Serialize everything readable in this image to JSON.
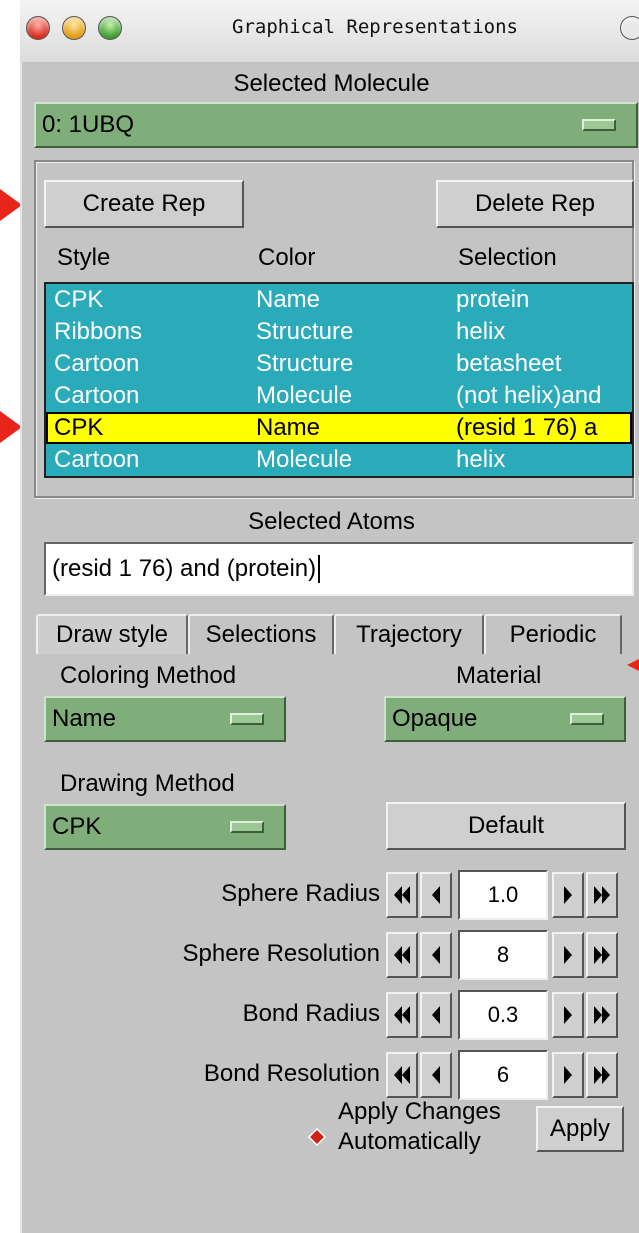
{
  "window": {
    "title": "Graphical Representations"
  },
  "selected_molecule": {
    "label": "Selected Molecule",
    "value": "0: 1UBQ"
  },
  "reps": {
    "create_label": "Create Rep",
    "delete_label": "Delete Rep",
    "columns": [
      "Style",
      "Color",
      "Selection"
    ],
    "rows": [
      {
        "style": "CPK",
        "color": "Name",
        "selection": "protein",
        "selected": false
      },
      {
        "style": "Ribbons",
        "color": "Structure",
        "selection": "helix",
        "selected": false
      },
      {
        "style": "Cartoon",
        "color": "Structure",
        "selection": "betasheet",
        "selected": false
      },
      {
        "style": "Cartoon",
        "color": "Molecule",
        "selection": "(not helix)and",
        "selected": false
      },
      {
        "style": "CPK",
        "color": "Name",
        "selection": "(resid 1 76) a",
        "selected": true
      },
      {
        "style": "Cartoon",
        "color": "Molecule",
        "selection": "helix",
        "selected": false
      }
    ],
    "list_color": "#2baab9",
    "selected_row_color": "#ffff00"
  },
  "selected_atoms": {
    "label": "Selected Atoms",
    "value": "(resid 1 76) and (protein)"
  },
  "tabs": [
    "Draw style",
    "Selections",
    "Trajectory",
    "Periodic"
  ],
  "active_tab": "Draw style",
  "draw_style": {
    "coloring_method_label": "Coloring Method",
    "coloring_method_value": "Name",
    "material_label": "Material",
    "material_value": "Opaque",
    "drawing_method_label": "Drawing Method",
    "drawing_method_value": "CPK",
    "default_label": "Default",
    "params": [
      {
        "label": "Sphere Radius",
        "value": "1.0"
      },
      {
        "label": "Sphere Resolution",
        "value": "8"
      },
      {
        "label": "Bond Radius",
        "value": "0.3"
      },
      {
        "label": "Bond Resolution",
        "value": "6"
      }
    ],
    "apply_changes_label_line1": "Apply Changes",
    "apply_changes_label_line2": "Automatically",
    "apply_label": "Apply"
  },
  "colors": {
    "menu_green": "#7fae7a",
    "marker_red": "#e8251a"
  }
}
